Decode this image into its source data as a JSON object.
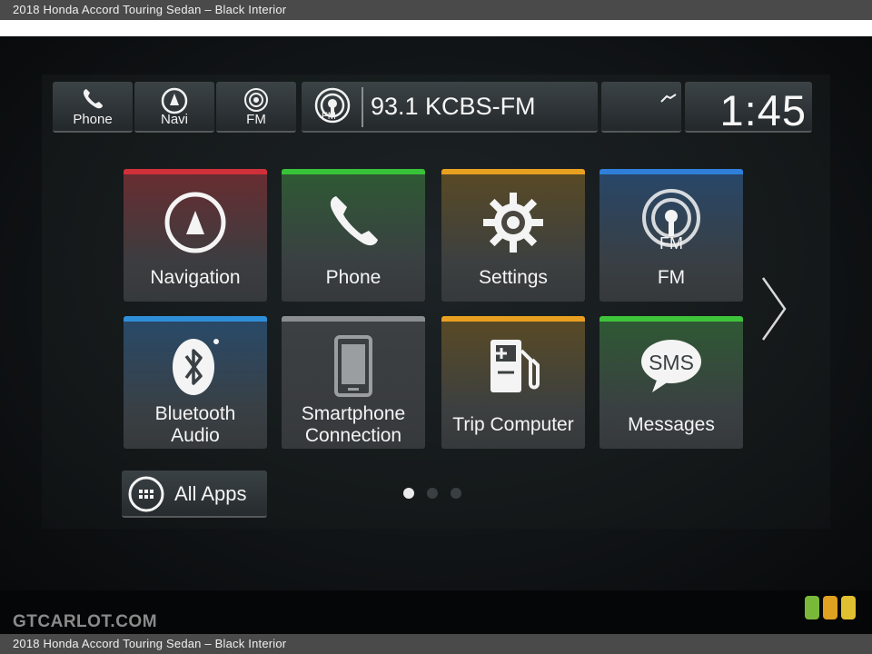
{
  "caption": {
    "top": "2018 Honda Accord Touring Sedan – Black Interior",
    "bottom": "2018 Honda Accord Touring Sedan – Black Interior"
  },
  "status_bar": {
    "phone_label": "Phone",
    "navi_label": "Navi",
    "fm_label": "FM",
    "station_icon_label": "FM",
    "station": "93.1 KCBS-FM",
    "clock": "1:45"
  },
  "tiles": [
    {
      "label": "Navigation",
      "accent": "#d0303a",
      "icon": "navigation-icon"
    },
    {
      "label": "Phone",
      "accent": "#38c23a",
      "icon": "phone-icon"
    },
    {
      "label": "Settings",
      "accent": "#e8a020",
      "icon": "gear-icon"
    },
    {
      "label": "FM",
      "icon_text": "FM",
      "accent": "#2f7fd8",
      "icon": "radio-icon"
    },
    {
      "label_line1": "Bluetooth",
      "label_line2": "Audio",
      "accent": "#2f8ed8",
      "icon": "bluetooth-icon"
    },
    {
      "label_line1": "Smartphone",
      "label_line2": "Connection",
      "accent": "#8a8e90",
      "icon": "smartphone-icon"
    },
    {
      "label": "Trip Computer",
      "accent": "#e8a020",
      "icon": "fuel-pump-icon"
    },
    {
      "label": "Messages",
      "icon_text": "SMS",
      "accent": "#3ec43a",
      "icon": "sms-bubble-icon"
    }
  ],
  "all_apps": {
    "label": "All Apps",
    "icon": "grid-icon"
  },
  "pagination": {
    "current_page": 1,
    "total_pages": 3
  },
  "watermark": "GTCARLOT.COM",
  "colors": {
    "tile_bg": "#3a4042",
    "screen_bg": "#161a1c"
  }
}
